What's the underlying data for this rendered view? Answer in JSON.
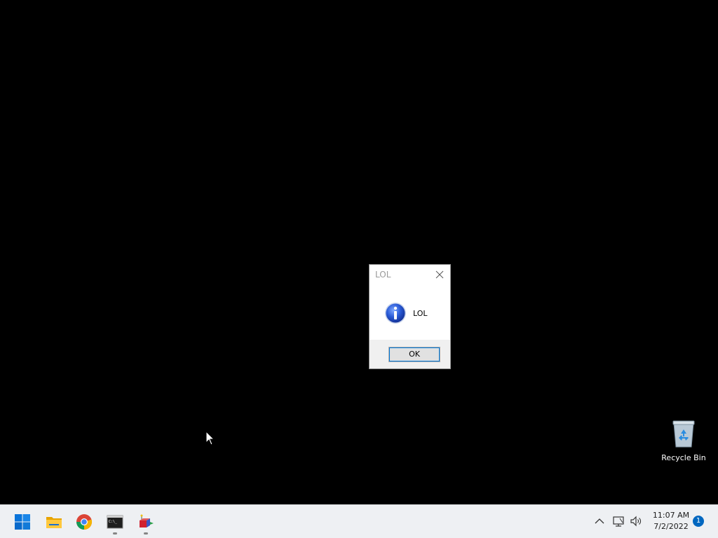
{
  "dialog": {
    "title": "LOL",
    "message": "LOL",
    "ok_label": "OK",
    "icon": "info-icon"
  },
  "desktop": {
    "recycle_bin_label": "Recycle Bin"
  },
  "taskbar": {
    "apps": [
      {
        "name": "start",
        "icon": "windows-logo-icon"
      },
      {
        "name": "file-explorer",
        "icon": "folder-icon"
      },
      {
        "name": "chrome",
        "icon": "chrome-icon"
      },
      {
        "name": "terminal",
        "icon": "terminal-icon",
        "running": true
      },
      {
        "name": "3d-app",
        "icon": "3d-shapes-icon",
        "running": true
      }
    ],
    "tray": {
      "icons": [
        "chevron-up-icon",
        "network-icon",
        "volume-icon"
      ],
      "time": "11:07 AM",
      "date": "7/2/2022",
      "notification_count": "1"
    }
  },
  "colors": {
    "desktop_background": "#000000",
    "taskbar_background": "#eef0f3",
    "accent": "#0067c0"
  }
}
